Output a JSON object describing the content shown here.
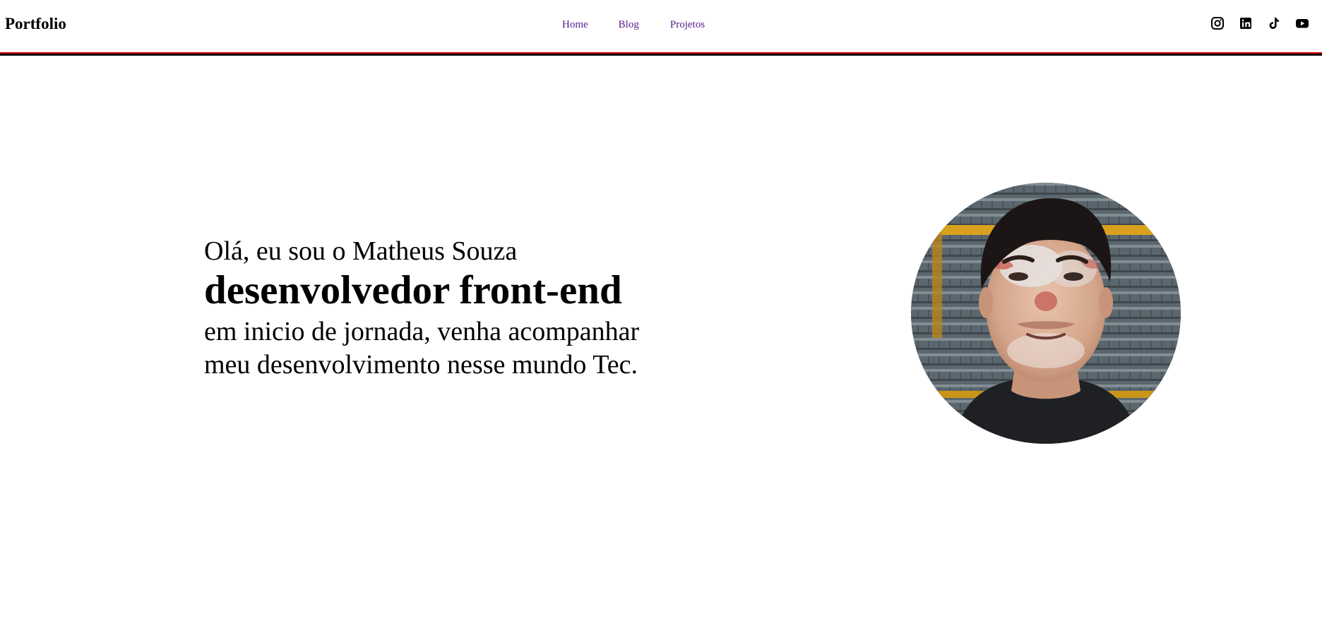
{
  "header": {
    "logo": "Portfolio",
    "nav": [
      {
        "label": "Home"
      },
      {
        "label": "Blog"
      },
      {
        "label": "Projetos"
      }
    ],
    "socials": [
      {
        "icon": "instagram-icon"
      },
      {
        "icon": "linkedin-icon"
      },
      {
        "icon": "tiktok-icon"
      },
      {
        "icon": "youtube-icon"
      }
    ]
  },
  "hero": {
    "greeting": "Olá, eu sou o Matheus Souza",
    "role": "desenvolvedor front-end",
    "tagline_line1": "em inicio de jornada, venha acompanhar",
    "tagline_line2": "meu desenvolvimento nesse mundo Tec."
  },
  "colors": {
    "link": "#551a8b",
    "divider_red": "#d40000",
    "divider_black": "#111111"
  }
}
